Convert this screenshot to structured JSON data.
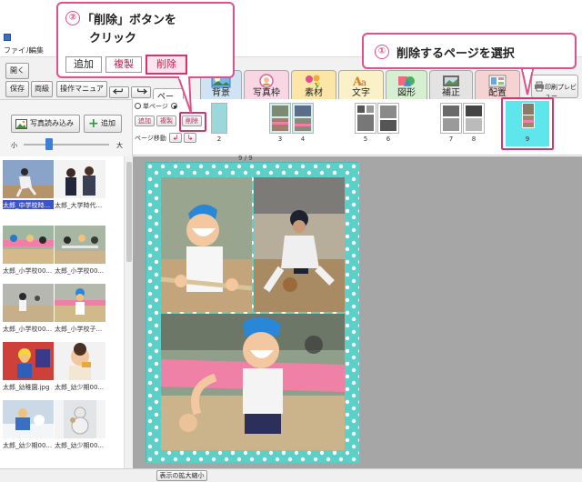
{
  "window": {
    "title": ""
  },
  "menu": {
    "file": "ファイル",
    "edit": "編集"
  },
  "toolbar": {
    "open": "開く",
    "save": "保存",
    "dup": "両級",
    "manual": "操作マニュアル",
    "preview": "印刷プレビュー",
    "page_tab": "ペー"
  },
  "categories": [
    {
      "id": "bg",
      "label": "背景",
      "color": "#cfe3f5"
    },
    {
      "id": "frame",
      "label": "写真枠",
      "color": "#f9d6e4"
    },
    {
      "id": "material",
      "label": "素材",
      "color": "#fbe6a8"
    },
    {
      "id": "text",
      "label": "文字",
      "color": "#fbf1c8"
    },
    {
      "id": "shape",
      "label": "図形",
      "color": "#d6efd0"
    },
    {
      "id": "correct",
      "label": "補正",
      "color": "#e3e3e3"
    },
    {
      "id": "layout",
      "label": "配置",
      "color": "#f6d3d3"
    }
  ],
  "pages_panel": {
    "single_page": "単ページ",
    "add": "追加",
    "dup": "複製",
    "delete": "削除",
    "move_label": "ページ移動",
    "counter": "9 / 9",
    "page_numbers": [
      "2",
      "3",
      "4",
      "5",
      "6",
      "7",
      "8",
      "9"
    ]
  },
  "left_panel": {
    "load_photos": "写真読み込み",
    "add": "追加",
    "size_small": "小",
    "size_large": "大",
    "slider_value": 0.3
  },
  "photos": [
    {
      "caption": "太郎_中学校時...",
      "selected": true
    },
    {
      "caption": "太郎_大学時代..."
    },
    {
      "caption": "太郎_小学校00..."
    },
    {
      "caption": "太郎_小学校00..."
    },
    {
      "caption": "太郎_小学校00..."
    },
    {
      "caption": "太郎_小学校子..."
    },
    {
      "caption": "太郎_幼稚園.jpg"
    },
    {
      "caption": "太郎_幼少期00..."
    },
    {
      "caption": "太郎_幼少期00..."
    },
    {
      "caption": "太郎_幼少期00..."
    }
  ],
  "status": {
    "zoom_button": "表示の拡大縮小"
  },
  "callout1": {
    "num": "①",
    "text": "削除するページを選択"
  },
  "callout2": {
    "num": "②",
    "line1": "「削除」ボタンを",
    "line2": "クリック",
    "btn_add": "追加",
    "btn_dup": "複製",
    "btn_delete": "削除"
  },
  "colors": {
    "accent": "#e0508a",
    "selected_thumb": "#5ee6ec",
    "canvas_bg": "#a6a6a6",
    "page_border": "#5ccfc8"
  }
}
